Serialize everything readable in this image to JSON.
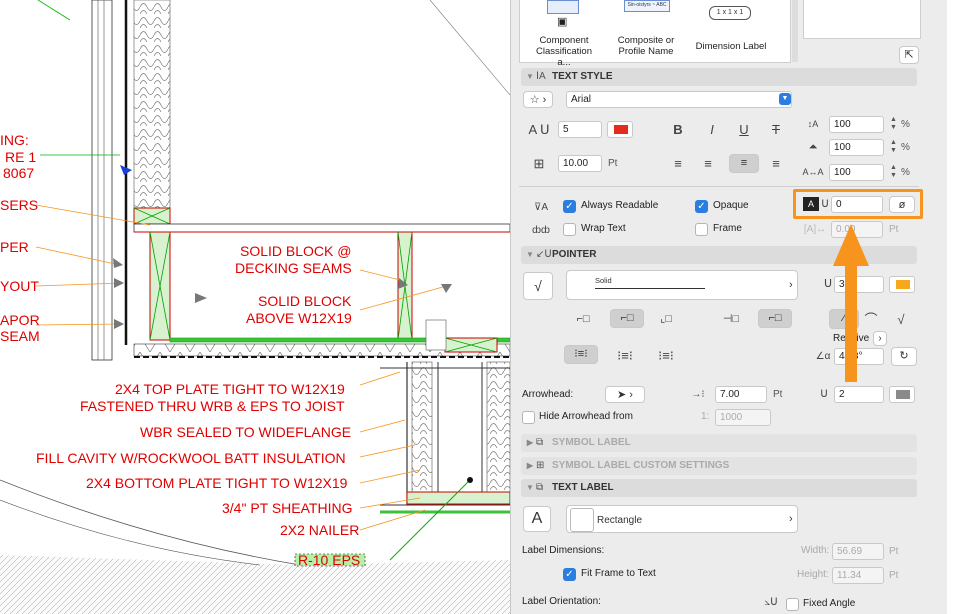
{
  "colors": {
    "cad_red": "#e00000",
    "cad_green": "#00b000",
    "annotation_orange": "#f7941d",
    "arrow_orange": "#f7941d",
    "accent_blue": "#2a7de1",
    "pen_red": "#e52b1b",
    "pen_orange": "#f7a81b",
    "pen_gray": "#8a8a8a"
  },
  "drawing": {
    "labels_partial": [
      "ING:",
      "RE 1",
      "8067",
      "SERS",
      "PER",
      "YOUT",
      "APOR",
      "SEAM"
    ],
    "labels": [
      "SOLID BLOCK @",
      "DECKING SEAMS",
      "SOLID BLOCK",
      "ABOVE W12X19",
      "2X4 TOP PLATE TIGHT TO W12X19",
      "FASTENED THRU WRB & EPS TO JOIST",
      "WBR SEALED TO WIDEFLANGE",
      "FILL CAVITY W/ROCKWOOL BATT INSULATION",
      "2X4 BOTTOM PLATE TIGHT TO W12X19",
      "3/4\" PT SHEATHING",
      "2X2 NAILER",
      "R-10 EPS"
    ]
  },
  "panel": {
    "label_types": [
      {
        "name": "Component Classification a...",
        "icon": "classification-icon"
      },
      {
        "name": "Composite or Profile Name",
        "icon": "composite-icon",
        "preview": "Sin-oistyrs ~ ABC"
      },
      {
        "name": "Dimension Label",
        "icon": "dimension-icon",
        "preview": "1 x 1 x 1"
      }
    ],
    "text_style": {
      "title": "TEXT STYLE",
      "font": "Arial",
      "size": "5",
      "pen_size": "10.00",
      "pen_unit": "Pt",
      "width_factor": "100",
      "spacing": "100",
      "char_spacing": "100",
      "percent": "%",
      "bold": "B",
      "italic": "I",
      "underline": "U",
      "strike": "T",
      "always_readable": "Always Readable",
      "always_readable_checked": true,
      "opaque": "Opaque",
      "opaque_checked": true,
      "wrap_text": "Wrap Text",
      "wrap_text_checked": false,
      "frame": "Frame",
      "frame_checked": false,
      "background_pen": "0",
      "background_pen_symbol": "ø",
      "frame_offset": "0.00",
      "frame_offset_unit": "Pt"
    },
    "pointer": {
      "title": "POINTER",
      "line_type": "Solid",
      "pen": "3",
      "relative_label": "Relative",
      "angle": "44.8°",
      "arrowhead_label": "Arrowhead:",
      "arrowhead_size": "7.00",
      "arrowhead_unit": "Pt",
      "arrowhead_pen": "2",
      "hide_arrowhead_label": "Hide Arrowhead from",
      "hide_ratio_prefix": "1:",
      "hide_ratio": "1000"
    },
    "symbol_label": {
      "title": "SYMBOL LABEL"
    },
    "symbol_label_custom": {
      "title": "SYMBOL LABEL CUSTOM SETTINGS"
    },
    "text_label": {
      "title": "TEXT LABEL",
      "shape": "Rectangle",
      "dimensions_label": "Label Dimensions:",
      "width_label": "Width:",
      "width": "56.69",
      "height_label": "Height:",
      "height": "11.34",
      "unit": "Pt",
      "fit_frame": "Fit Frame to Text",
      "fit_frame_checked": true,
      "orientation_label": "Label Orientation:",
      "fixed_angle": "Fixed Angle",
      "fixed_angle_checked": false
    }
  }
}
